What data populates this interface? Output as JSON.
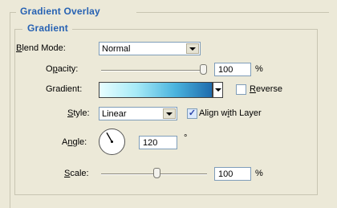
{
  "group_outer_title": "Gradient Overlay",
  "group_inner_title": "Gradient",
  "blend_mode": {
    "label_u": "B",
    "label_rest": "lend Mode:",
    "value": "Normal"
  },
  "opacity": {
    "label_pre": "O",
    "label_u": "p",
    "label_post": "acity:",
    "value": "100",
    "unit": "%",
    "level": 1.0
  },
  "gradient": {
    "label": "Gradient:",
    "colors": [
      "#e8feff",
      "#a6eaf7",
      "#4bb4de",
      "#1f6cad"
    ]
  },
  "reverse": {
    "label_u": "R",
    "label_rest": "everse",
    "checked": false
  },
  "style": {
    "label_u": "S",
    "label_rest": "tyle:",
    "value": "Linear"
  },
  "align_with_layer": {
    "label_pre": "Align w",
    "label_u": "i",
    "label_post": "th Layer",
    "checked": true
  },
  "angle": {
    "label_pre": "A",
    "label_u": "n",
    "label_post": "gle:",
    "value": "120",
    "unit": "°"
  },
  "scale": {
    "label_u": "S",
    "label_rest": "cale:",
    "value": "100",
    "unit": "%",
    "level": 0.53
  }
}
